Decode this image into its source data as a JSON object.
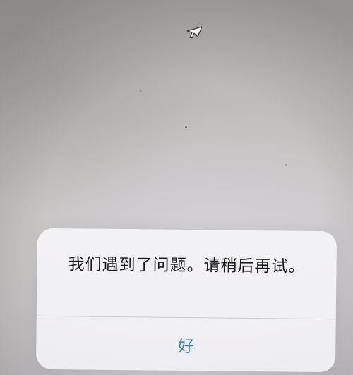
{
  "alert": {
    "message": "我们遇到了问题。请稍后再试。",
    "ok_label": "好"
  },
  "colors": {
    "ok_button": "#3d78c8",
    "message_text": "#1a1a1c"
  },
  "icons": {
    "cursor": "mouse-pointer-arrow"
  }
}
